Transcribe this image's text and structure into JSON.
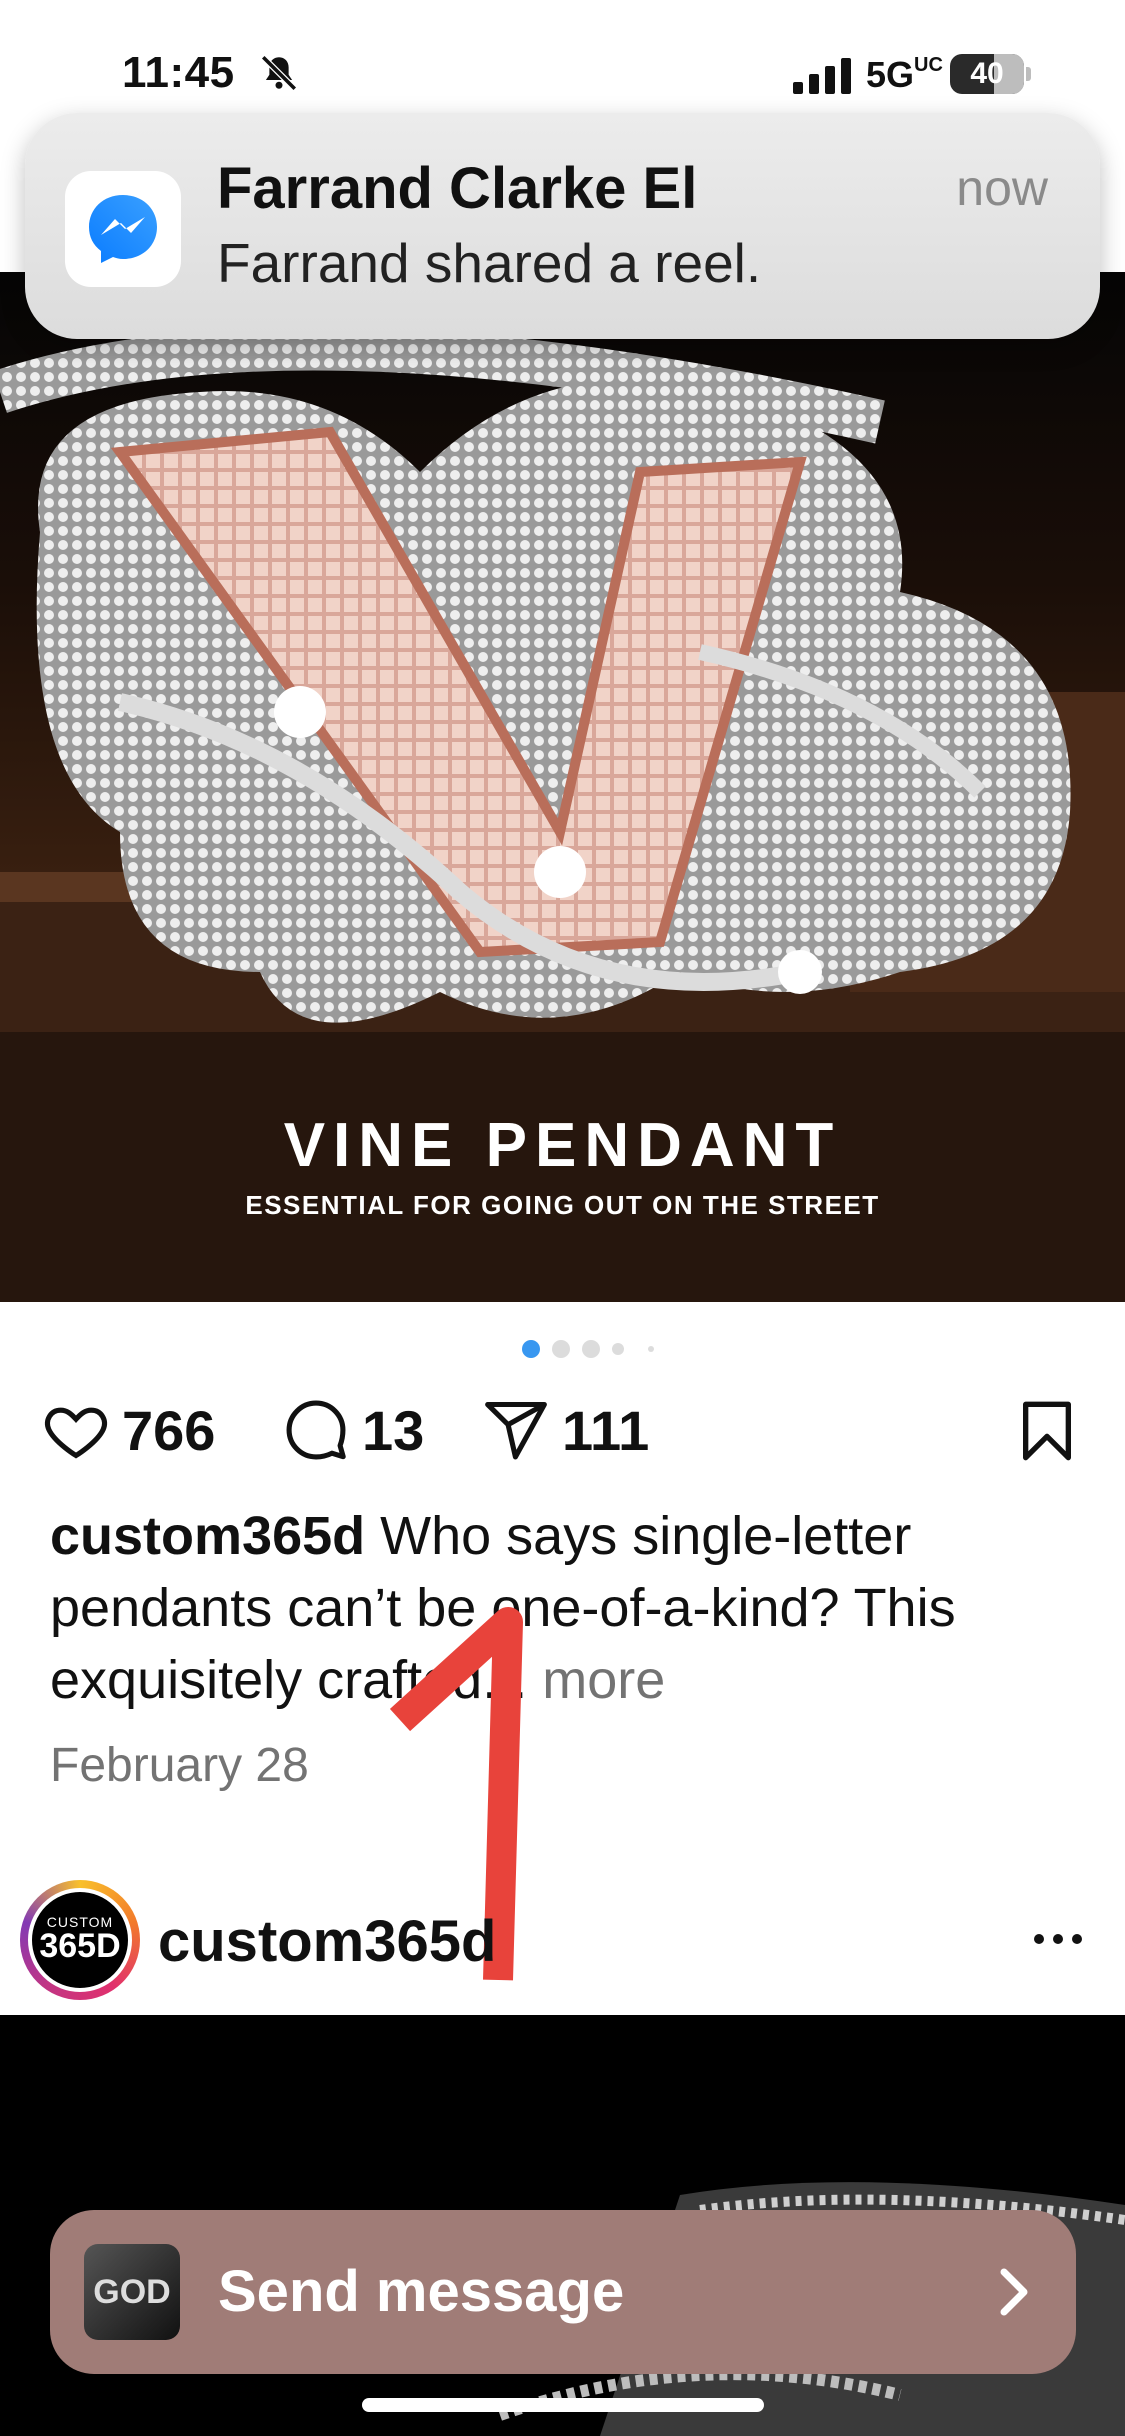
{
  "status_bar": {
    "time": "11:45",
    "network": "5G",
    "network_suffix": "UC",
    "battery": "40"
  },
  "notification": {
    "app_icon": "messenger-icon",
    "title": "Farrand Clarke El",
    "time": "now",
    "body": "Farrand shared a reel."
  },
  "post": {
    "image_title": "VINE PENDANT",
    "image_subtitle": "ESSENTIAL FOR GOING OUT ON THE STREET",
    "likes": "766",
    "comments": "13",
    "shares": "111",
    "caption_user": "custom365d",
    "caption_text": " Who says single-letter pendants can’t be one-of-a-kind? This exquisitely crafted...",
    "more_label": " more",
    "date": "February 28",
    "carousel_dots": 5,
    "carousel_active": 0
  },
  "next_post": {
    "avatar_text_top": "CUSTOM",
    "avatar_text_main": "365D",
    "username": "custom365d"
  },
  "send_bar": {
    "thumb_text": "GOD",
    "label": "Send message"
  },
  "annotation": {
    "mark": "1",
    "color": "#e8433b"
  },
  "colors": {
    "accent_blue": "#3897f0",
    "send_bar": "#a07c77",
    "muted_text": "#737373"
  }
}
